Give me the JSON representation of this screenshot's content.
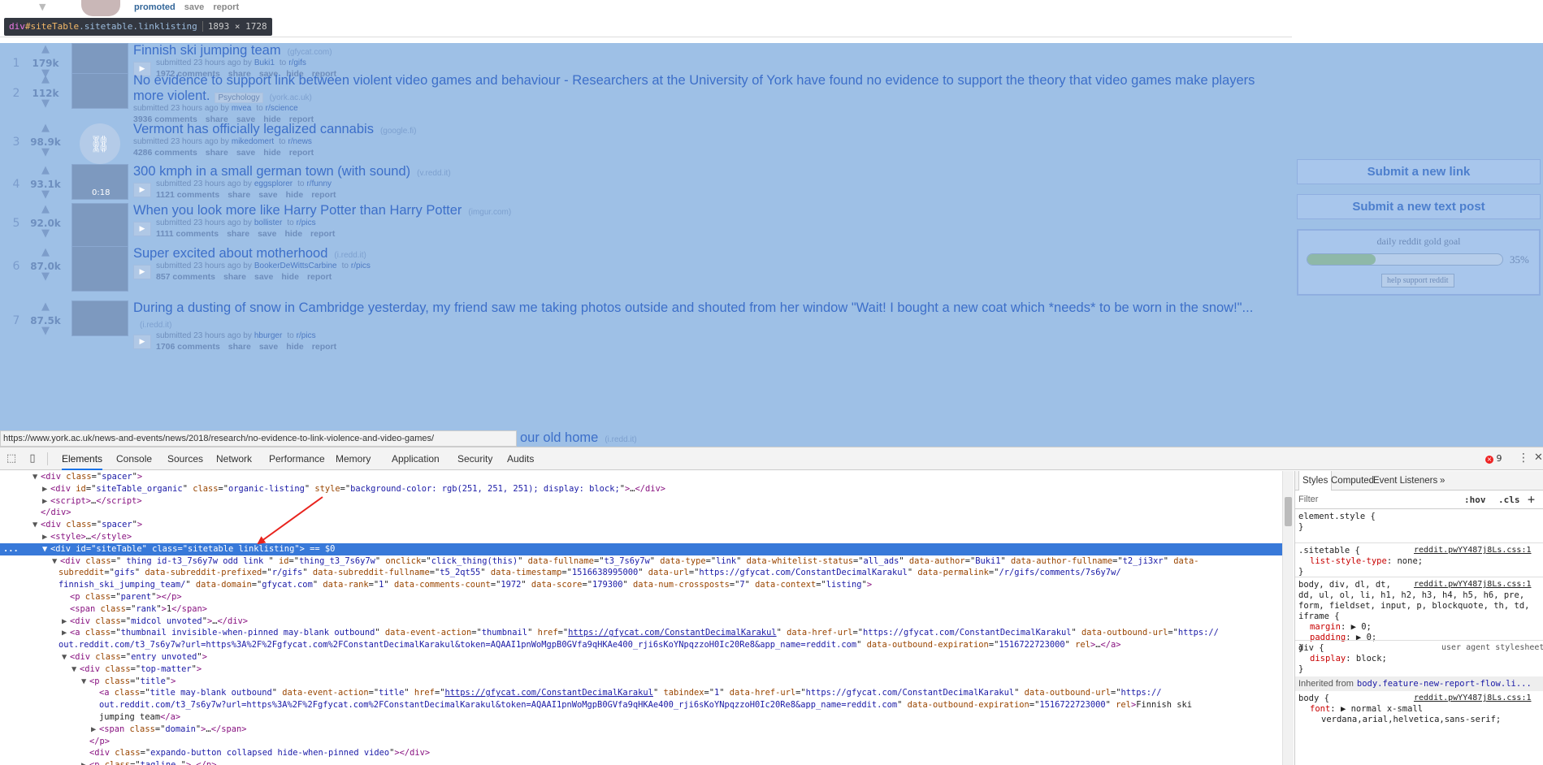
{
  "promo": {
    "promoted_label": "promoted",
    "actions": [
      "save",
      "report"
    ]
  },
  "tooltip": {
    "tag": "div",
    "id": "#siteTable",
    "classes": ".sitetable.linklisting",
    "dims": "1893 × 1728"
  },
  "posts": [
    {
      "rank": "1",
      "score": "179k",
      "title": "Finnish ski jumping team",
      "domain": "(gfycat.com)",
      "flair": "",
      "submitted": "submitted 23 hours ago by",
      "author": "Buki1",
      "to": "to",
      "subreddit": "r/gifs",
      "comments": "1972 comments",
      "thumb": "image"
    },
    {
      "rank": "2",
      "score": "112k",
      "title": "No evidence to support link between violent video games and behaviour - Researchers at the University of York have found no evidence to support the theory that video games make players more violent.",
      "domain": "(york.ac.uk)",
      "flair": "Psychology",
      "submitted": "submitted 23 hours ago by",
      "author": "mvea",
      "to": "to",
      "subreddit": "r/science",
      "comments": "3936 comments",
      "thumb": "image"
    },
    {
      "rank": "3",
      "score": "98.9k",
      "title": "Vermont has officially legalized cannabis",
      "domain": "(google.fi)",
      "flair": "",
      "submitted": "submitted 23 hours ago by",
      "author": "mikedomert",
      "to": "to",
      "subreddit": "r/news",
      "comments": "4286 comments",
      "thumb": "link"
    },
    {
      "rank": "4",
      "score": "93.1k",
      "title": "300 kmph in a small german town (with sound)",
      "domain": "(v.redd.it)",
      "flair": "",
      "submitted": "submitted 23 hours ago by",
      "author": "eggsplorer",
      "to": "to",
      "subreddit": "r/funny",
      "comments": "1121 comments",
      "thumb": "video",
      "duration": "0:18"
    },
    {
      "rank": "5",
      "score": "92.0k",
      "title": "When you look more like Harry Potter than Harry Potter",
      "domain": "(imgur.com)",
      "flair": "",
      "submitted": "submitted 23 hours ago by",
      "author": "bollister",
      "to": "to",
      "subreddit": "r/pics",
      "comments": "1111 comments",
      "thumb": "image"
    },
    {
      "rank": "6",
      "score": "87.0k",
      "title": "Super excited about motherhood",
      "domain": "(i.redd.it)",
      "flair": "",
      "submitted": "submitted 23 hours ago by",
      "author": "BookerDeWittsCarbine",
      "to": "to",
      "subreddit": "r/pics",
      "comments": "857 comments",
      "thumb": "image"
    },
    {
      "rank": "7",
      "score": "87.5k",
      "title": "During a dusting of snow in Cambridge yesterday, my friend saw me taking photos outside and shouted from her window \"Wait! I bought a new coat which *needs* to be worn in the snow!\"...",
      "domain": "(i.redd.it)",
      "flair": "",
      "submitted": "submitted 23 hours ago by",
      "author": "hburger",
      "to": "to",
      "subreddit": "r/pics",
      "comments": "1706 comments",
      "thumb": "image"
    }
  ],
  "post_actions": [
    "share",
    "save",
    "hide",
    "report"
  ],
  "partial_post": {
    "title": "our old home",
    "domain": "(i.redd.it)"
  },
  "sidebar": {
    "submit_link": "Submit a new link",
    "submit_text": "Submit a new text post",
    "gold_label": "daily reddit gold goal",
    "gold_percent": "35%",
    "gold_fraction": 0.35,
    "help_button": "help support reddit"
  },
  "status_url": "https://www.york.ac.uk/news-and-events/news/2018/research/no-evidence-to-link-violence-and-video-games/",
  "devtools": {
    "tabs": [
      "Elements",
      "Console",
      "Sources",
      "Network",
      "Performance",
      "Memory",
      "Application",
      "Security",
      "Audits"
    ],
    "active_tab": "Elements",
    "error_count": "9",
    "dom_lines": [
      {
        "indent": 0,
        "tri": "▼",
        "html": "<span class=\"t\">&lt;div</span> <span class=\"a\">class</span>=\"<span class=\"v\">spacer</span>\"<span class=\"t\">&gt;</span>"
      },
      {
        "indent": 1,
        "tri": "▶",
        "html": "<span class=\"t\">&lt;div</span> <span class=\"a\">id</span>=\"<span class=\"v\">siteTable_organic</span>\" <span class=\"a\">class</span>=\"<span class=\"v\">organic-listing</span>\" <span class=\"a\">style</span>=\"<span class=\"v\">background-color: rgb(251, 251, 251); display: block;</span>\"<span class=\"t\">&gt;</span>…<span class=\"t\">&lt;/div&gt;</span>"
      },
      {
        "indent": 1,
        "tri": "▶",
        "html": "<span class=\"t\">&lt;script&gt;</span>…<span class=\"t\">&lt;/script&gt;</span>"
      },
      {
        "indent": 0,
        "tri": "",
        "html": "<span class=\"t\">&lt;/div&gt;</span>"
      },
      {
        "indent": 0,
        "tri": "▼",
        "html": "<span class=\"t\">&lt;div</span> <span class=\"a\">class</span>=\"<span class=\"v\">spacer</span>\"<span class=\"t\">&gt;</span>"
      },
      {
        "indent": 1,
        "tri": "▶",
        "html": "<span class=\"t\">&lt;style&gt;</span>…<span class=\"t\">&lt;/style&gt;</span>"
      },
      {
        "indent": 1,
        "tri": "▼",
        "html": "<span class=\"t\">&lt;div</span> <span class=\"a\">id</span>=\"<span class=\"v\">siteTable</span>\" <span class=\"a\">class</span>=\"<span class=\"v\">sitetable linklisting</span>\"<span class=\"t\">&gt;</span> == $0",
        "selected": true
      },
      {
        "indent": 2,
        "tri": "▼",
        "html": "<span class=\"t\">&lt;div</span> <span class=\"a\">class</span>=\"<span class=\"v\"> thing id-t3_7s6y7w odd  link </span>\" <span class=\"a\">id</span>=\"<span class=\"v\">thing_t3_7s6y7w</span>\" <span class=\"a\">onclick</span>=\"<span class=\"v\">click_thing(this)</span>\" <span class=\"a\">data-fullname</span>=\"<span class=\"v\">t3_7s6y7w</span>\" <span class=\"a\">data-type</span>=\"<span class=\"v\">link</span>\" <span class=\"a\">data-whitelist-status</span>=\"<span class=\"v\">all_ads</span>\" <span class=\"a\">data-author</span>=\"<span class=\"v\">Buki1</span>\" <span class=\"a\">data-author-fullname</span>=\"<span class=\"v\">t2_ji3xr</span>\" <span class=\"a\">data-</span>"
      },
      {
        "indent": 2,
        "tri": "",
        "html": "<span class=\"a\">subreddit</span>=\"<span class=\"v\">gifs</span>\" <span class=\"a\">data-subreddit-prefixed</span>=\"<span class=\"v\">r/gifs</span>\" <span class=\"a\">data-subreddit-fullname</span>=\"<span class=\"v\">t5_2qt55</span>\" <span class=\"a\">data-timestamp</span>=\"<span class=\"v\">1516638995000</span>\" <span class=\"a\">data-url</span>=\"<span class=\"v\">https://gfycat.com/ConstantDecimalKarakul</span>\" <span class=\"a\">data-permalink</span>=\"<span class=\"v\">/r/gifs/comments/7s6y7w/</span>"
      },
      {
        "indent": 2,
        "tri": "",
        "html": "<span class=\"v\">finnish_ski_jumping_team/</span>\" <span class=\"a\">data-domain</span>=\"<span class=\"v\">gfycat.com</span>\" <span class=\"a\">data-rank</span>=\"<span class=\"v\">1</span>\" <span class=\"a\">data-comments-count</span>=\"<span class=\"v\">1972</span>\" <span class=\"a\">data-score</span>=\"<span class=\"v\">179300</span>\" <span class=\"a\">data-num-crossposts</span>=\"<span class=\"v\">7</span>\" <span class=\"a\">data-context</span>=\"<span class=\"v\">listing</span>\"<span class=\"t\">&gt;</span>"
      },
      {
        "indent": 3,
        "tri": "",
        "html": "<span class=\"t\">&lt;p</span> <span class=\"a\">class</span>=\"<span class=\"v\">parent</span>\"<span class=\"t\">&gt;&lt;/p&gt;</span>"
      },
      {
        "indent": 3,
        "tri": "",
        "html": "<span class=\"t\">&lt;span</span> <span class=\"a\">class</span>=\"<span class=\"v\">rank</span>\"<span class=\"t\">&gt;</span>1<span class=\"t\">&lt;/span&gt;</span>"
      },
      {
        "indent": 3,
        "tri": "▶",
        "html": "<span class=\"t\">&lt;div</span> <span class=\"a\">class</span>=\"<span class=\"v\">midcol unvoted</span>\"<span class=\"t\">&gt;</span>…<span class=\"t\">&lt;/div&gt;</span>"
      },
      {
        "indent": 3,
        "tri": "▶",
        "html": "<span class=\"t\">&lt;a</span> <span class=\"a\">class</span>=\"<span class=\"v\">thumbnail invisible-when-pinned may-blank outbound</span>\" <span class=\"a\">data-event-action</span>=\"<span class=\"v\">thumbnail</span>\" <span class=\"a\">href</span>=\"<span class=\"lk\">https://gfycat.com/ConstantDecimalKarakul</span>\" <span class=\"a\">data-href-url</span>=\"<span class=\"v\">https://gfycat.com/ConstantDecimalKarakul</span>\" <span class=\"a\">data-outbound-url</span>=\"<span class=\"v\">https://</span>"
      },
      {
        "indent": 2,
        "tri": "",
        "html": "<span class=\"v\">out.reddit.com/t3_7s6y7w?url=https%3A%2F%2Fgfycat.com%2FConstantDecimalKarakul&amp;token=AQAAI1pnWoMgpB0GVfa9qHKAe400_rji6sKoYNpqzzoH0Ic20Re8&amp;app_name=reddit.com</span>\" <span class=\"a\">data-outbound-expiration</span>=\"<span class=\"v\">1516722723000</span>\" <span class=\"a\">rel</span><span class=\"t\">&gt;</span>…<span class=\"t\">&lt;/a&gt;</span>"
      },
      {
        "indent": 3,
        "tri": "▼",
        "html": "<span class=\"t\">&lt;div</span> <span class=\"a\">class</span>=\"<span class=\"v\">entry unvoted</span>\"<span class=\"t\">&gt;</span>"
      },
      {
        "indent": 4,
        "tri": "▼",
        "html": "<span class=\"t\">&lt;div</span> <span class=\"a\">class</span>=\"<span class=\"v\">top-matter</span>\"<span class=\"t\">&gt;</span>"
      },
      {
        "indent": 5,
        "tri": "▼",
        "html": "<span class=\"t\">&lt;p</span> <span class=\"a\">class</span>=\"<span class=\"v\">title</span>\"<span class=\"t\">&gt;</span>"
      },
      {
        "indent": 6,
        "tri": "",
        "html": "<span class=\"t\">&lt;a</span> <span class=\"a\">class</span>=\"<span class=\"v\">title may-blank outbound</span>\" <span class=\"a\">data-event-action</span>=\"<span class=\"v\">title</span>\" <span class=\"a\">href</span>=\"<span class=\"lk\">https://gfycat.com/ConstantDecimalKarakul</span>\" <span class=\"a\">tabindex</span>=\"<span class=\"v\">1</span>\" <span class=\"a\">data-href-url</span>=\"<span class=\"v\">https://gfycat.com/ConstantDecimalKarakul</span>\" <span class=\"a\">data-outbound-url</span>=\"<span class=\"v\">https://</span>"
      },
      {
        "indent": 6,
        "tri": "",
        "html": "<span class=\"v\">out.reddit.com/t3_7s6y7w?url=https%3A%2F%2Fgfycat.com%2FConstantDecimalKarakul&amp;token=AQAAI1pnWoMgpB0GVfa9qHKAe400_rji6sKoYNpqzzoH0Ic20Re8&amp;app_name=reddit.com</span>\" <span class=\"a\">data-outbound-expiration</span>=\"<span class=\"v\">1516722723000</span>\" <span class=\"a\">rel</span><span class=\"t\">&gt;</span>Finnish ski"
      },
      {
        "indent": 6,
        "tri": "",
        "html": "jumping team<span class=\"t\">&lt;/a&gt;</span>"
      },
      {
        "indent": 6,
        "tri": "▶",
        "html": "<span class=\"t\">&lt;span</span> <span class=\"a\">class</span>=\"<span class=\"v\">domain</span>\"<span class=\"t\">&gt;</span>…<span class=\"t\">&lt;/span&gt;</span>"
      },
      {
        "indent": 5,
        "tri": "",
        "html": "<span class=\"t\">&lt;/p&gt;</span>"
      },
      {
        "indent": 5,
        "tri": "",
        "html": "<span class=\"t\">&lt;div</span> <span class=\"a\">class</span>=\"<span class=\"v\">expando-button collapsed hide-when-pinned video</span>\"<span class=\"t\">&gt;&lt;/div&gt;</span>"
      },
      {
        "indent": 5,
        "tri": "▶",
        "html": "<span class=\"t\">&lt;p</span> <span class=\"a\">class</span>=\"<span class=\"v\">tagline </span>\"<span class=\"t\">&gt;</span>…<span class=\"t\">&lt;/p&gt;</span>"
      }
    ],
    "ellipsis": "...",
    "styles_tabs": [
      "Styles",
      "Computed",
      "Event Listeners"
    ],
    "styles_more": "»",
    "filter_placeholder": "Filter",
    "hov": ":hov",
    "cls": ".cls",
    "plus": "+",
    "rules": [
      {
        "selector": "element.style {",
        "src": "",
        "props": [],
        "close": "}"
      },
      {
        "selector": ".sitetable {",
        "src": "reddit.pwYY487j8Ls.css:1",
        "props": [
          [
            "list-style-type",
            "none;"
          ]
        ],
        "close": "}"
      },
      {
        "selector": "body, div, dl, dt,",
        "src": "reddit.pwYY487j8Ls.css:1",
        "extra": [
          "dd, ul, ol, li, h1, h2, h3, h4, h5, h6, pre,",
          "form, fieldset, input, p, blockquote, th, td,",
          "iframe {"
        ],
        "props": [
          [
            "margin",
            "▶ 0;"
          ],
          [
            "padding",
            "▶ 0;"
          ]
        ],
        "close": "}"
      },
      {
        "selector": "div {",
        "src": "user agent stylesheet",
        "props": [
          [
            "display",
            "block;"
          ]
        ],
        "close": "}"
      }
    ],
    "inherited_label": "Inherited from",
    "inherited_from": "body.feature-new-report-flow.li...",
    "body_rule": {
      "selector": "body {",
      "src": "reddit.pwYY487j8Ls.css:1",
      "props": [
        [
          "font",
          "▶ normal x-small"
        ]
      ],
      "cont": "verdana,arial,helvetica,sans-serif;"
    }
  }
}
